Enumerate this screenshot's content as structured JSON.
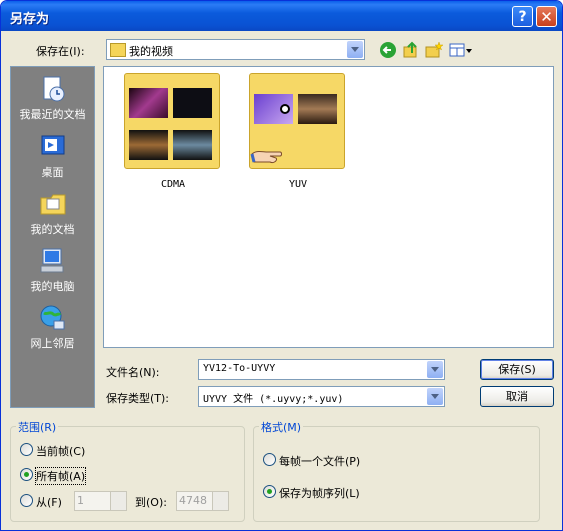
{
  "window": {
    "title": "另存为",
    "help": "?",
    "close": "✕"
  },
  "save_in": {
    "label": "保存在(I):",
    "value": "我的视频"
  },
  "places": [
    {
      "label": "我最近的文档",
      "icon": "recent-documents-icon"
    },
    {
      "label": "桌面",
      "icon": "desktop-icon"
    },
    {
      "label": "我的文档",
      "icon": "my-documents-icon"
    },
    {
      "label": "我的电脑",
      "icon": "my-computer-icon"
    },
    {
      "label": "网上邻居",
      "icon": "network-places-icon"
    }
  ],
  "folders": [
    {
      "name": "CDMA"
    },
    {
      "name": "YUV"
    }
  ],
  "filename": {
    "label": "文件名(N):",
    "value": "YV12-To-UYVY"
  },
  "filetype": {
    "label": "保存类型(T):",
    "value": "UYVY 文件 (*.uyvy;*.yuv)"
  },
  "buttons": {
    "save": "保存(S)",
    "cancel": "取消"
  },
  "range": {
    "title": "范围(R)",
    "current": "当前帧(C)",
    "all": "所有帧(A)",
    "from": "从(F)",
    "from_value": "1",
    "to": "到(O):",
    "to_value": "4748"
  },
  "format": {
    "title": "格式(M)",
    "per_frame": "每帧一个文件(P)",
    "sequence": "保存为帧序列(L)"
  }
}
